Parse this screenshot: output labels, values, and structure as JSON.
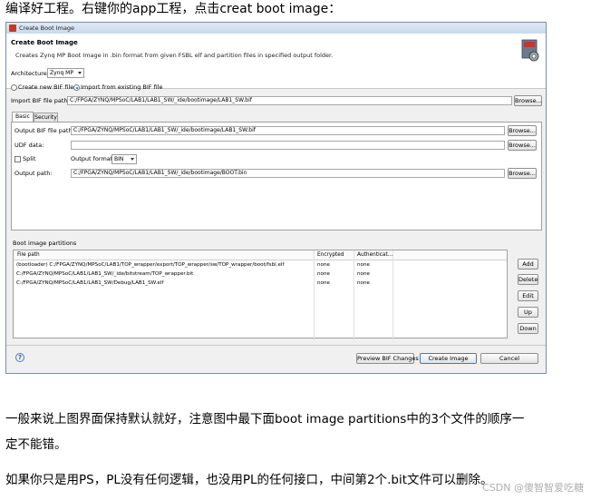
{
  "article": {
    "top_text": "编译好工程。右键你的app工程，点击creat boot image：",
    "para1a": "一般来说上图界面保持默认就好，注意图中最下面boot image partitions中的3个文件的顺序一",
    "para1b": "定不能错。",
    "para2": "如果你只是用PS，PL没有任何逻辑，也没用PL的任何接口，中间第2个.bit文件可以删除。",
    "watermark": "CSDN @傻智智爱吃糖"
  },
  "dialog": {
    "window_title": "Create Boot Image",
    "header_title": "Create Boot Image",
    "header_desc": "Creates Zynq MP Boot Image in .bin format from given FSBL elf and partition files in specified output folder.",
    "architecture_label": "Architecture:",
    "architecture_value": "Zynq MP",
    "radio_new": "Create new BIF file",
    "radio_import": "Import from existing BIF file",
    "import_bif_label": "Import BIF file path:",
    "import_bif_value": "C:/FPGA/ZYNQ/MPSoC/LAB1/LAB1_SW/_ide/bootimage/LAB1_SW.bif",
    "browse_label": "Browse...",
    "tabs": [
      "Basic",
      "Security"
    ],
    "output_bif_label": "Output BIF file path:",
    "output_bif_value": "C:/FPGA/ZYNQ/MPSoC/LAB1/LAB1_SW/_ide/bootimage/LAB1_SW.bif",
    "udf_label": "UDF data:",
    "split_label": "Split",
    "output_format_label": "Output format:",
    "output_format_value": "BIN",
    "output_path_label": "Output path:",
    "output_path_value": "C:/FPGA/ZYNQ/MPSoC/LAB1/LAB1_SW/_ide/bootimage/BOOT.bin",
    "partitions_label": "Boot image partitions",
    "columns": [
      "File path",
      "Encrypted",
      "Authenticat..."
    ],
    "rows": [
      {
        "path": "(bootloader) C:/FPGA/ZYNQ/MPSoC/LAB1/TOP_wrapper/export/TOP_wrapper/sw/TOP_wrapper/boot/fsbl.elf",
        "enc": "none",
        "auth": "none"
      },
      {
        "path": "C:/FPGA/ZYNQ/MPSoC/LAB1/LAB1_SW/_ide/bitstream/TOP_wrapper.bit",
        "enc": "none",
        "auth": "none"
      },
      {
        "path": "C:/FPGA/ZYNQ/MPSoC/LAB1/LAB1_SW/Debug/LAB1_SW.elf",
        "enc": "none",
        "auth": "none"
      }
    ],
    "side_buttons": [
      "Add",
      "Delete",
      "Edit",
      "Up",
      "Down"
    ],
    "help_glyph": "?",
    "btn_preview": "Preview BIF Changes",
    "btn_create": "Create Image",
    "btn_cancel": "Cancel"
  }
}
